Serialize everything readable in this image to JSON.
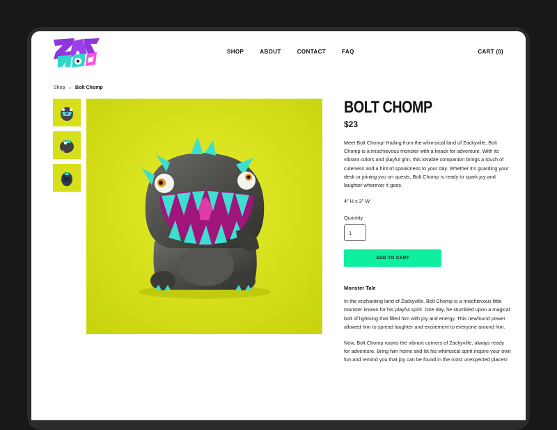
{
  "brand": {
    "logo_text": "ZACKY MILOS",
    "colors": {
      "purple": "#8e36e0",
      "teal": "#2ed8c9",
      "pink": "#ff4fd8"
    }
  },
  "nav": {
    "items": [
      "SHOP",
      "ABOUT",
      "CONTACT",
      "FAQ"
    ],
    "cart": "CART (0)"
  },
  "breadcrumb": {
    "parent": "Shop",
    "separator": "›",
    "current": "Bolt Chomp"
  },
  "gallery": {
    "thumb_count": 3,
    "background": "#d8e01a"
  },
  "product": {
    "title": "BOLT CHOMP",
    "price": "$23",
    "description": "Meet Bolt Chomp! Hailing from the whimsical land of Zackyville, Bolt Chomp is a mischievous monster with a knack for adventure. With its vibrant colors and playful grin, this lovable companion brings a touch of cuteness and a hint of spookiness to your day. Whether it's guarding your desk or joining you on quests, Bolt Chomp is ready to spark joy and laughter wherever it goes.",
    "dimensions": "4\" H x 3\" W",
    "quantity_label": "Quantity",
    "quantity_value": "1",
    "add_to_cart": "ADD TO CART",
    "button_color": "#10ef9f"
  },
  "tale": {
    "title": "Monster Tale",
    "paragraphs": [
      "In the enchanting land of Zackyville, Bolt Chomp is a mischievous little monster known for his playful spirit. One day, he stumbled upon a magical bolt of lightning that filled him with joy and energy. This newfound power allowed him to spread laughter and excitement to everyone around him.",
      "Now, Bolt Chomp roams the vibrant corners of Zackyville, always ready for adventure. Bring him home and let his whimsical spirit inspire your own fun and remind you that joy can be found in the most unexpected places!"
    ]
  }
}
